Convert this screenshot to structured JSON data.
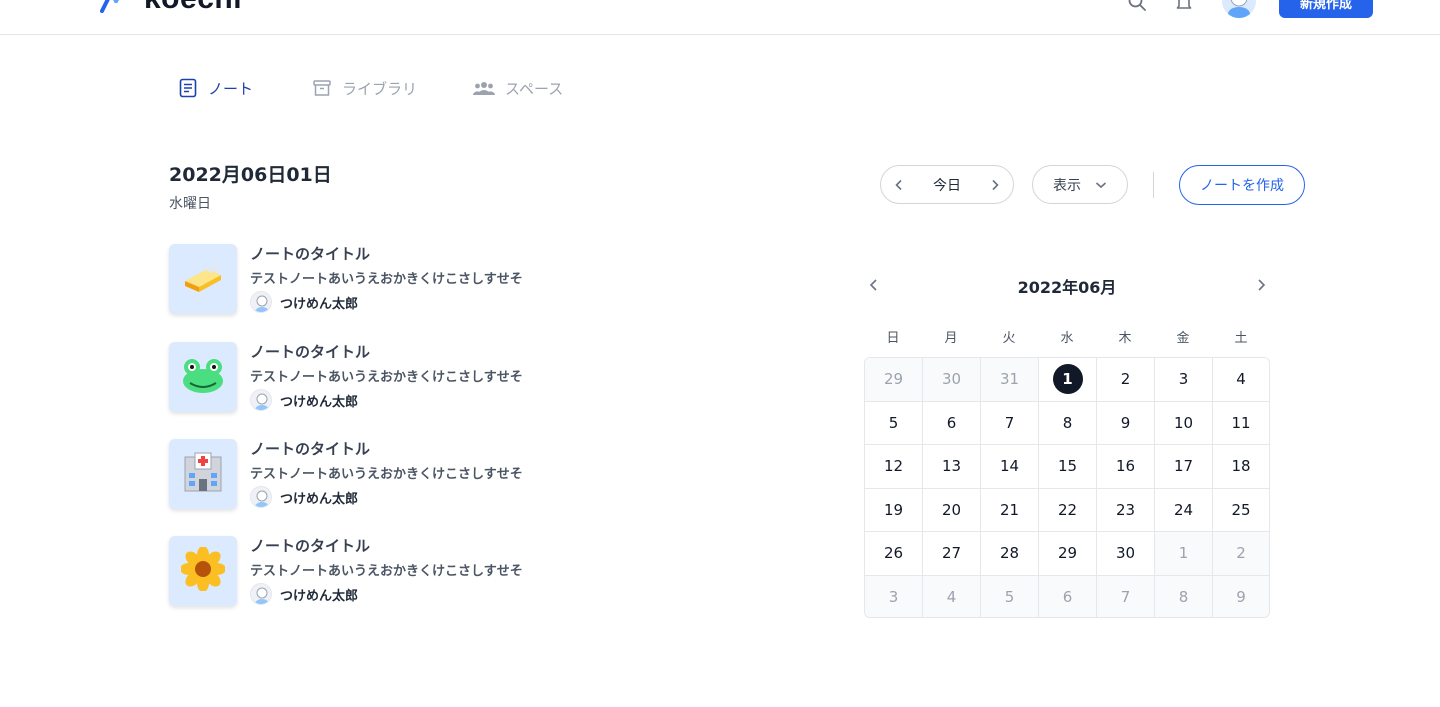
{
  "app": {
    "name": "koechi"
  },
  "header": {
    "new_button": "新規作成"
  },
  "tabs": [
    {
      "label": "ノート",
      "active": true
    },
    {
      "label": "ライブラリ",
      "active": false
    },
    {
      "label": "スペース",
      "active": false
    }
  ],
  "date": {
    "title": "2022月06日01日",
    "weekday": "水曜日"
  },
  "toolbar": {
    "today": "今日",
    "view": "表示",
    "create_note": "ノートを作成"
  },
  "notes": [
    {
      "icon": "butter-icon",
      "title": "ノートのタイトル",
      "body": "テストノートあいうえおかきくけこさしすせそ",
      "author": "つけめん太郎"
    },
    {
      "icon": "frog-icon",
      "title": "ノートのタイトル",
      "body": "テストノートあいうえおかきくけこさしすせそ",
      "author": "つけめん太郎"
    },
    {
      "icon": "hospital-icon",
      "title": "ノートのタイトル",
      "body": "テストノートあいうえおかきくけこさしすせそ",
      "author": "つけめん太郎"
    },
    {
      "icon": "sunflower-icon",
      "title": "ノートのタイトル",
      "body": "テストノートあいうえおかきくけこさしすせそ",
      "author": "つけめん太郎"
    }
  ],
  "calendar": {
    "month": "2022年06月",
    "weekdays": [
      "日",
      "月",
      "火",
      "水",
      "木",
      "金",
      "土"
    ],
    "weeks": [
      [
        {
          "d": "29",
          "out": true
        },
        {
          "d": "30",
          "out": true
        },
        {
          "d": "31",
          "out": true
        },
        {
          "d": "1",
          "today": true
        },
        {
          "d": "2"
        },
        {
          "d": "3"
        },
        {
          "d": "4"
        }
      ],
      [
        {
          "d": "5"
        },
        {
          "d": "6"
        },
        {
          "d": "7"
        },
        {
          "d": "8"
        },
        {
          "d": "9"
        },
        {
          "d": "10"
        },
        {
          "d": "11"
        }
      ],
      [
        {
          "d": "12"
        },
        {
          "d": "13"
        },
        {
          "d": "14"
        },
        {
          "d": "15"
        },
        {
          "d": "16"
        },
        {
          "d": "17"
        },
        {
          "d": "18"
        }
      ],
      [
        {
          "d": "19"
        },
        {
          "d": "20"
        },
        {
          "d": "21"
        },
        {
          "d": "22"
        },
        {
          "d": "23"
        },
        {
          "d": "24"
        },
        {
          "d": "25"
        }
      ],
      [
        {
          "d": "26"
        },
        {
          "d": "27"
        },
        {
          "d": "28"
        },
        {
          "d": "29"
        },
        {
          "d": "30"
        },
        {
          "d": "1",
          "out": true
        },
        {
          "d": "2",
          "out": true
        }
      ],
      [
        {
          "d": "3",
          "out": true
        },
        {
          "d": "4",
          "out": true
        },
        {
          "d": "5",
          "out": true
        },
        {
          "d": "6",
          "out": true
        },
        {
          "d": "7",
          "out": true
        },
        {
          "d": "8",
          "out": true
        },
        {
          "d": "9",
          "out": true
        }
      ]
    ]
  },
  "colors": {
    "accent": "#2563eb",
    "today_bg": "#111827",
    "thumb_bg": "#dbeafe"
  }
}
